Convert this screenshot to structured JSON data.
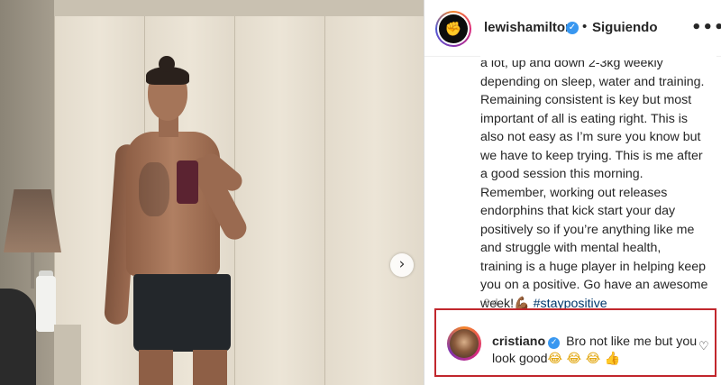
{
  "post": {
    "username": "lewishamilton",
    "follow_status": "Siguiendo",
    "separator": "•",
    "more_label": "•••",
    "avatar_glyph": "✊",
    "caption_text": "a lot, up and down 2-3kg weekly\ndepending on sleep, water and training.\nRemaining consistent is key but most\nimportant of all is eating right. This is\nalso not easy as I’m sure you know but\nwe have to keep trying. This is me after\na good session this morning.\nRemember, working out releases\nendorphins that kick start your day\npositively so if you’re anything like me\nand struggle with mental health,\ntraining is a huge player in helping keep\nyou on a positive. Go have an awesome\nweek!💪🏾 ",
    "hashtag": "#staypositive",
    "time_ago": "3 d"
  },
  "media": {
    "next_glyph": "›"
  },
  "comment": {
    "username": "cristiano",
    "text": " Bro not like me but you look good",
    "emojis": "😂 😂 😂 👍",
    "heart_glyph": "♡"
  },
  "icons": {
    "verified": "verified-badge-icon",
    "heart": "heart-icon",
    "more": "more-options-icon"
  },
  "colors": {
    "highlight_border": "#c1272d",
    "verified_blue": "#3897f0",
    "hashtag": "#00376b"
  }
}
